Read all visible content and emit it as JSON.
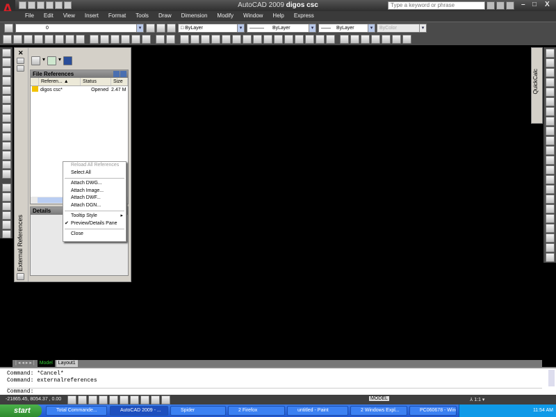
{
  "app": {
    "logo": "A",
    "title": "AutoCAD 2009",
    "doc": "digos csc",
    "search_placeholder": "Type a keyword or phrase"
  },
  "menu": [
    "File",
    "Edit",
    "View",
    "Insert",
    "Format",
    "Tools",
    "Draw",
    "Dimension",
    "Modify",
    "Window",
    "Help",
    "Express"
  ],
  "properties": {
    "layer": "0",
    "color": "ByLayer",
    "linetype": "ByLayer",
    "lineweight": "ByLayer",
    "plotstyle": "ByColor"
  },
  "xref": {
    "palette_title": "External References",
    "file_refs_header": "File References",
    "columns": [
      "Referen...",
      "Status",
      "Size"
    ],
    "rows": [
      {
        "name": "digos csc*",
        "status": "Opened",
        "size": "2.47 M"
      }
    ],
    "details_header": "Details"
  },
  "context_menu": {
    "items": [
      {
        "label": "Reload All References",
        "disabled": true
      },
      {
        "label": "Select All"
      },
      {
        "sep": true
      },
      {
        "label": "Attach DWG..."
      },
      {
        "label": "Attach Image..."
      },
      {
        "label": "Attach DWF..."
      },
      {
        "label": "Attach DGN..."
      },
      {
        "sep": true
      },
      {
        "label": "Tooltip Style",
        "submenu": true
      },
      {
        "label": "Preview/Details Pane",
        "checked": true
      },
      {
        "sep": true
      },
      {
        "label": "Close"
      }
    ]
  },
  "quickcalc": "QuickCalc",
  "tabs": [
    "Model",
    "Layout1"
  ],
  "command": {
    "lines": [
      "Command: *Cancel*",
      "Command: externalreferences"
    ],
    "prompt": "Command:"
  },
  "status": {
    "coords": "-21865.45, 8054.37 , 0.00",
    "model": "MODEL",
    "scale": "1:1"
  },
  "taskbar": {
    "start": "start",
    "tasks": [
      "Total Commande...",
      "AutoCAD 2009 - ...",
      "Spider",
      "2 Firefox",
      "untitled - Paint",
      "2 Windows Expl...",
      "PC060678 - Wind..."
    ],
    "active": 1,
    "clock": "11:54 AM"
  }
}
